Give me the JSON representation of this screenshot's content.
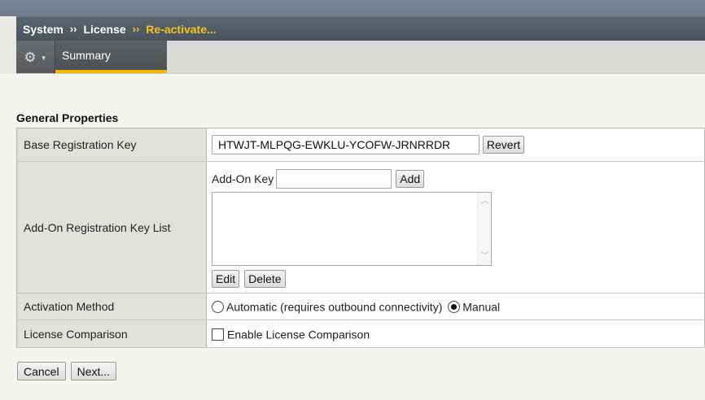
{
  "breadcrumb": {
    "items": [
      {
        "label": "System"
      },
      {
        "label": "License"
      },
      {
        "label": "Re-activate..."
      }
    ],
    "separator": "››",
    "active_color": "#f5c21b"
  },
  "tabs": {
    "menu_icon": "gear-icon",
    "summary": "Summary",
    "accent_color": "#f5b800"
  },
  "section": {
    "title": "General Properties"
  },
  "form": {
    "base_key": {
      "label": "Base Registration Key",
      "value": "HTWJT-MLPQG-EWKLU-YCOFW-JRNRRDR",
      "revert_label": "Revert"
    },
    "addon": {
      "label": "Add-On Registration Key List",
      "key_label": "Add-On Key",
      "key_value": "",
      "add_label": "Add",
      "edit_label": "Edit",
      "delete_label": "Delete",
      "items": []
    },
    "activation": {
      "label": "Activation Method",
      "options": [
        {
          "label": "Automatic (requires outbound connectivity)",
          "selected": false
        },
        {
          "label": "Manual",
          "selected": true
        }
      ]
    },
    "comparison": {
      "label": "License Comparison",
      "checkbox_label": "Enable License Comparison",
      "checked": false
    }
  },
  "footer": {
    "cancel_label": "Cancel",
    "next_label": "Next..."
  }
}
